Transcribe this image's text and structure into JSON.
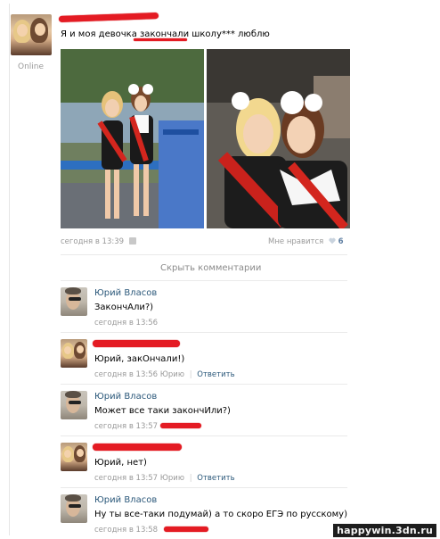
{
  "post": {
    "author_status": "Online",
    "text": "Я и моя девочка закончали школу*** люблю",
    "time": "сегодня в 13:39",
    "likes_label": "Мне нравится",
    "likes_count": "6",
    "hide_comments": "Скрыть комментарии"
  },
  "comments": [
    {
      "name": "Юрий Власов",
      "text": "ЗакончАли?)",
      "time": "сегодня в 13:56",
      "reply_to": "",
      "reply": ""
    },
    {
      "name": "",
      "text": "Юрий, закОнчали!)",
      "time": "сегодня в 13:56",
      "reply_to": "Юрию",
      "reply": "Ответить"
    },
    {
      "name": "Юрий Власов",
      "text": "Может все таки закончИли?)",
      "time": "сегодня в 13:57",
      "reply_to": "",
      "reply": ""
    },
    {
      "name": "",
      "text": "Юрий, нет)",
      "time": "сегодня в 13:57",
      "reply_to": "Юрию",
      "reply": "Ответить"
    },
    {
      "name": "Юрий Власов",
      "text": "Ну ты все-таки подумай) а то скоро ЕГЭ по русскому)",
      "time": "сегодня в 13:58",
      "reply_to": "",
      "reply": ""
    }
  ],
  "watermark": "happywin.3dn.ru",
  "colors": {
    "link": "#2b587a",
    "meta": "#999999",
    "redact": "#e41b23",
    "heart": "#9fb1c6"
  }
}
